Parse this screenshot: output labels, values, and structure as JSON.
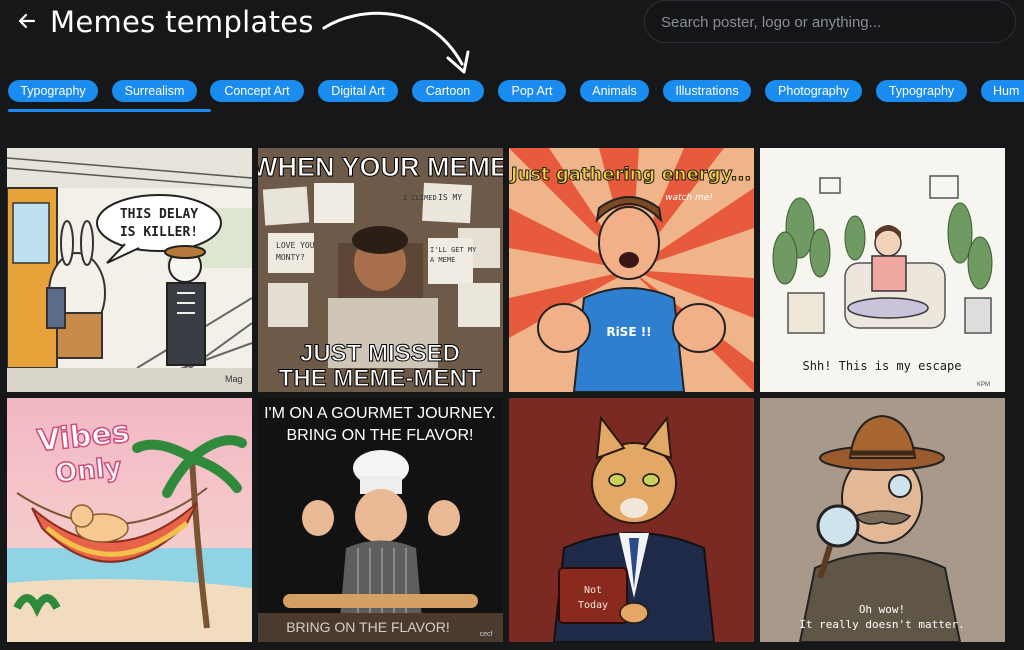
{
  "header": {
    "title": "Memes templates",
    "search_placeholder": "Search poster, logo or anything..."
  },
  "categories": [
    "Typography",
    "Surrealism",
    "Concept Art",
    "Digital Art",
    "Cartoon",
    "Pop Art",
    "Animals",
    "Illustrations",
    "Photography",
    "Typography",
    "Hum"
  ],
  "cards": [
    {
      "id": "delay",
      "bubble_line1": "THIS DELAY",
      "bubble_line2": "IS KILLER!",
      "signature": "Mag"
    },
    {
      "id": "meme",
      "top": "WHEN YOUR MEME",
      "bottom1": "JUST MISSED",
      "bottom2": "THE MEME-MENT",
      "notes": [
        "IS MY",
        "LOVE YOU",
        "MONTY?",
        "I CLIMED",
        "I'LL GET MY",
        "A MEME"
      ]
    },
    {
      "id": "energy",
      "caption": "Just gathering energy...",
      "aside": "watch me!",
      "shirt": "RiSE !!"
    },
    {
      "id": "escape",
      "caption": "Shh! This is my escape",
      "signature": "KPM"
    },
    {
      "id": "vibes",
      "line1": "Vibes",
      "line2": "Only"
    },
    {
      "id": "gourmet",
      "top1": "I'M ON A GOURMET JOURNEY.",
      "top2": "BRING ON THE FLAVOR!",
      "bottom": "BRING ON THE FLAVOR!",
      "signature": "cecf"
    },
    {
      "id": "cat",
      "sign1": "Not",
      "sign2": "Today"
    },
    {
      "id": "detective",
      "caption1": "Oh wow!",
      "caption2": "It really doesn't matter."
    }
  ],
  "colors": {
    "accent": "#1a8cf0",
    "background": "#161719"
  }
}
